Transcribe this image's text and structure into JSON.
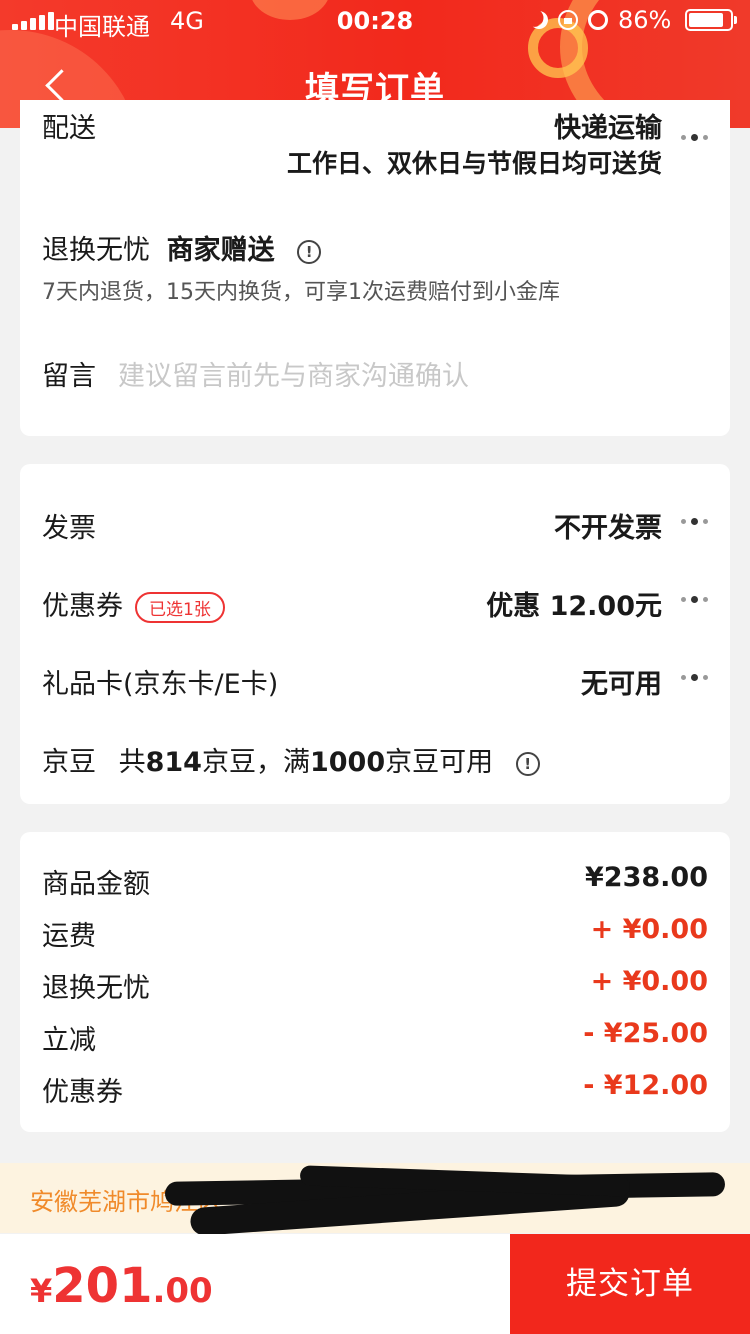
{
  "status_bar": {
    "carrier": "中国联通",
    "network": "4G",
    "time": "00:28",
    "battery_pct": "86%"
  },
  "header": {
    "title": "填写订单"
  },
  "delivery": {
    "partial_label": "配送",
    "partial_value": "快递运输",
    "schedule": "工作日、双休日与节假日均可送货"
  },
  "return_service": {
    "label": "退换无忧",
    "tag": "商家赠送",
    "description": "7天内退货，15天内换货，可享1次运费赔付到小金库"
  },
  "message": {
    "label": "留言",
    "placeholder": "建议留言前先与商家沟通确认"
  },
  "payment_options": {
    "invoice_label": "发票",
    "invoice_value": "不开发票",
    "coupon_label": "优惠券",
    "coupon_tag": "已选1张",
    "coupon_value": "优惠 12.00元",
    "giftcard_label": "礼品卡(京东卡/E卡)",
    "giftcard_value": "无可用",
    "jingdou_label": "京豆",
    "jingdou_text_1": "共",
    "jingdou_count": "814",
    "jingdou_text_2": "京豆，满",
    "jingdou_threshold": "1000",
    "jingdou_text_3": "京豆可用"
  },
  "summary": {
    "items": [
      {
        "label": "商品金额",
        "value": "¥238.00"
      },
      {
        "label": "运费",
        "value": "+ ¥0.00"
      },
      {
        "label": "退换无忧",
        "value": "+ ¥0.00"
      },
      {
        "label": "立减",
        "value": "- ¥25.00"
      },
      {
        "label": "优惠券",
        "value": "- ¥12.00"
      }
    ]
  },
  "address": {
    "text": "安徽芜湖市鸠江区"
  },
  "footer": {
    "currency": "¥",
    "total_integer": "201",
    "total_decimal": ".00",
    "submit_label": "提交订单"
  },
  "colors": {
    "accent": "#f2271c",
    "price_red": "#e9391c",
    "address_bg": "#fdf3e0",
    "address_text": "#f08a2a"
  }
}
